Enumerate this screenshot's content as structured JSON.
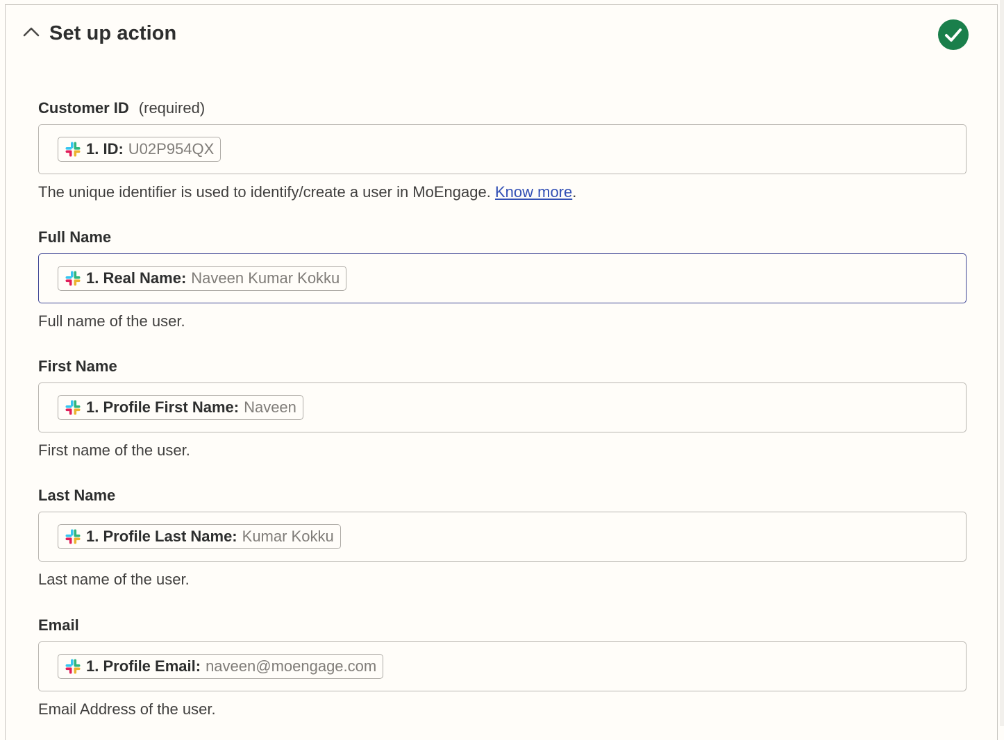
{
  "header": {
    "title": "Set up action",
    "collapse_icon": "chevron-up-icon",
    "status_icon": "check-circle-icon",
    "status_color": "#1a7f4b"
  },
  "fields": [
    {
      "label": "Customer ID",
      "required": "(required)",
      "pill_key": "1. ID:",
      "pill_value": "U02P954QX",
      "help": "The unique identifier is used to identify/create a user in MoEngage.",
      "help_link": "Know more",
      "help_suffix": "."
    },
    {
      "label": "Full Name",
      "pill_key": "1. Real Name:",
      "pill_value": "Naveen Kumar Kokku",
      "help": "Full name of the user."
    },
    {
      "label": "First Name",
      "pill_key": "1. Profile First Name:",
      "pill_value": "Naveen",
      "help": "First name of the user."
    },
    {
      "label": "Last Name",
      "pill_key": "1. Profile Last Name:",
      "pill_value": "Kumar Kokku",
      "help": "Last name of the user."
    },
    {
      "label": "Email",
      "pill_key": "1. Profile Email:",
      "pill_value": "naveen@moengage.com",
      "help": "Email Address of the user."
    }
  ],
  "pill_icon": "slack-icon",
  "colors": {
    "link": "#3350b5",
    "focus_border": "#3d4595",
    "pill_value": "#7f7c78"
  }
}
